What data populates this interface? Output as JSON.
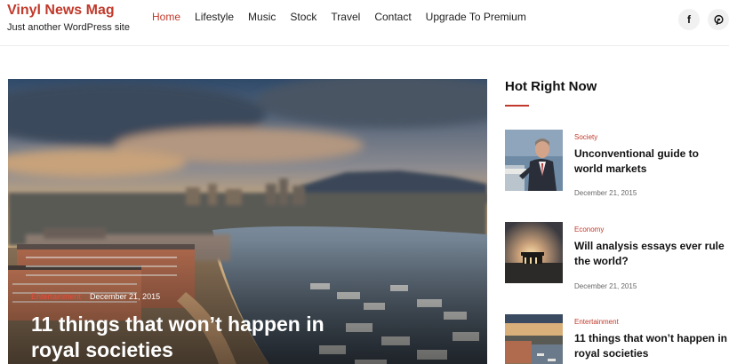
{
  "site": {
    "title": "Vinyl News Mag",
    "tagline": "Just another WordPress site"
  },
  "nav": {
    "items": [
      {
        "label": "Home",
        "active": true
      },
      {
        "label": "Lifestyle",
        "active": false
      },
      {
        "label": "Music",
        "active": false
      },
      {
        "label": "Stock",
        "active": false
      },
      {
        "label": "Travel",
        "active": false
      },
      {
        "label": "Contact",
        "active": false
      },
      {
        "label": "Upgrade To Premium",
        "active": false
      }
    ]
  },
  "social": {
    "facebook_glyph": "f",
    "icons": [
      "facebook-icon",
      "pinterest-icon"
    ]
  },
  "hero": {
    "category": "Entertainment",
    "date": "December 21, 2015",
    "title": "11 things that won’t happen in royal societies"
  },
  "sidebar": {
    "title": "Hot Right Now",
    "posts": [
      {
        "category": "Society",
        "title": "Unconventional guide to world markets",
        "date": "December 21, 2015"
      },
      {
        "category": "Economy",
        "title": "Will analysis essays ever rule the world?",
        "date": "December 21, 2015"
      },
      {
        "category": "Entertainment",
        "title": "11 things that won’t happen in royal societies",
        "date": ""
      }
    ]
  },
  "colors": {
    "accent": "#c0392b",
    "hero_category": "#e74c3c"
  }
}
